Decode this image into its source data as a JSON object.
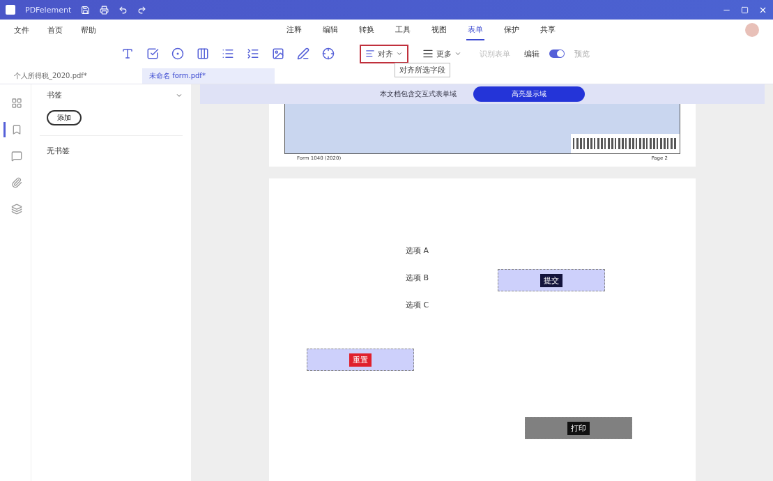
{
  "title_bar": {
    "title": "PDFelement"
  },
  "menu": {
    "left": [
      "文件",
      "首页",
      "帮助"
    ],
    "tabs": [
      {
        "label": "注释",
        "selected": false
      },
      {
        "label": "编辑",
        "selected": false
      },
      {
        "label": "转换",
        "selected": false
      },
      {
        "label": "工具",
        "selected": false
      },
      {
        "label": "视图",
        "selected": false
      },
      {
        "label": "表单",
        "selected": true
      },
      {
        "label": "保护",
        "selected": false
      },
      {
        "label": "共享",
        "selected": false
      }
    ]
  },
  "toolbar": {
    "align": {
      "label": "对齐",
      "selected": true
    },
    "more": "更多",
    "recognize": {
      "label": "识别表单",
      "disabled": true
    },
    "mode": {
      "edit": "编辑",
      "preview": "预览",
      "on": true
    },
    "tooltip": "对齐所选字段"
  },
  "doc_tabs": [
    {
      "label": "个人所得税_2020.pdf*",
      "selected": false
    },
    {
      "label": "未命名 form.pdf*",
      "selected": true
    }
  ],
  "panel": {
    "title": "书签",
    "button": "添加",
    "empty": "无书签"
  },
  "rail": [
    {
      "selected": false
    },
    {
      "selected": true
    },
    {
      "selected": false
    },
    {
      "selected": false
    },
    {
      "selected": false
    }
  ],
  "banner": {
    "message": "本文档包含交互式表单域",
    "button": "高亮显示域"
  },
  "top_page": {
    "left_caption": "Form 1040 (2020)",
    "right_caption": "Page 2"
  },
  "labels": [
    "选项 A",
    "选项 B",
    "选项 C"
  ],
  "fields": [
    {
      "text": "提交",
      "color": "#14143c",
      "selected": true
    },
    {
      "text": "重置",
      "color": "#e0202c",
      "selected": true
    },
    {
      "text": "打印",
      "color": "#101010",
      "selected": false
    }
  ]
}
